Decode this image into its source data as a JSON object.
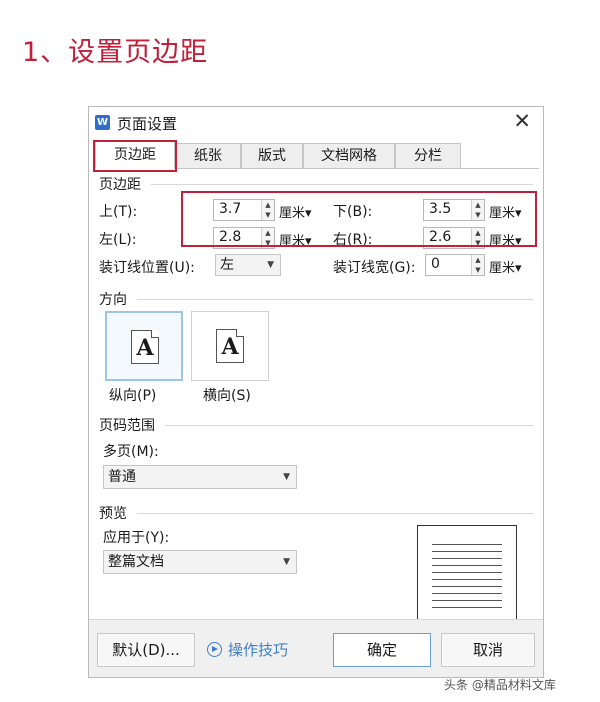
{
  "heading": "1、设置页边距",
  "window": {
    "icon": "W",
    "title": "页面设置",
    "close": "✕"
  },
  "tabs": [
    "页边距",
    "纸张",
    "版式",
    "文档网格",
    "分栏"
  ],
  "margins": {
    "section": "页边距",
    "top": {
      "label": "上(T):",
      "value": "3.7",
      "unit": "厘米"
    },
    "bottom": {
      "label": "下(B):",
      "value": "3.5",
      "unit": "厘米"
    },
    "left": {
      "label": "左(L):",
      "value": "2.8",
      "unit": "厘米"
    },
    "right": {
      "label": "右(R):",
      "value": "2.6",
      "unit": "厘米"
    },
    "gutter_pos": {
      "label": "装订线位置(U):",
      "value": "左"
    },
    "gutter_width": {
      "label": "装订线宽(G):",
      "value": "0",
      "unit": "厘米"
    }
  },
  "orientation": {
    "section": "方向",
    "selected": "portrait",
    "portrait": {
      "label": "纵向(P)",
      "glyph": "A"
    },
    "landscape": {
      "label": "横向(S)",
      "glyph": "A"
    }
  },
  "pages": {
    "section": "页码范围",
    "label": "多页(M):",
    "value": "普通"
  },
  "preview": {
    "section": "预览",
    "apply_label": "应用于(Y):",
    "apply_value": "整篇文档"
  },
  "footer": {
    "default": "默认(D)...",
    "tips": "操作技巧",
    "ok": "确定",
    "cancel": "取消"
  },
  "watermark": "头条 @精品材料文库",
  "colors": {
    "highlight": "#c0203a",
    "link": "#3e7fc8",
    "selected_border": "#9cc5e8"
  }
}
